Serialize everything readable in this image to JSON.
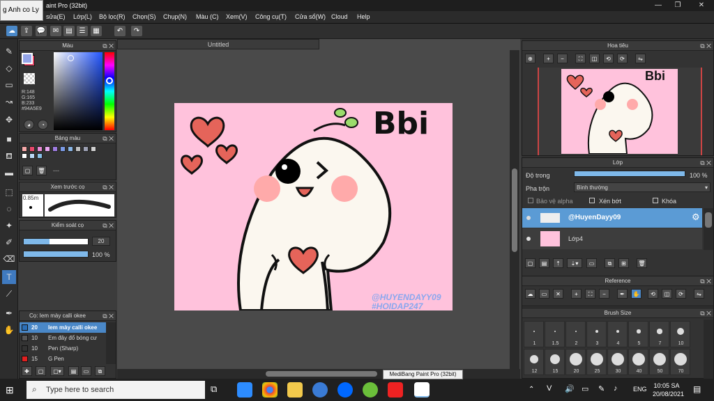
{
  "app": {
    "title": "aint Pro (32bit)",
    "tooltip_left": "g Anh co Ly"
  },
  "window_controls": {
    "minimize": "—",
    "maximize": "❐",
    "close": "✕"
  },
  "menu": [
    "sửa(E)",
    "Lớp(L)",
    "Bộ lọc(R)",
    "Chọn(S)",
    "Chụp(N)",
    "Màu (C)",
    "Xem(V)",
    "Công cụ(T)",
    "Cửa sổ(W)",
    "Cloud",
    "Help"
  ],
  "doc_tab": "Untitled",
  "artwork": {
    "text_bbi": "Bbi",
    "watermark1": "@HUYENDAYY09",
    "watermark2": "#HOIDAP247",
    "bg_color": "#ffc2dc"
  },
  "color_panel": {
    "title": "Màu",
    "r": "R:148",
    "g": "G:165",
    "b": "B:233",
    "hex": "#94A5E9",
    "current_color": "#94A5E9"
  },
  "palette_panel": {
    "title": "Bảng màu",
    "swatches": [
      "#f6a9a9",
      "#e8476b",
      "#e88ad6",
      "#e9a6f0",
      "#9d7be0",
      "#7b9be6",
      "#8ab6e6",
      "#c0c0c0",
      "#9ca0b3",
      "#d0d0d0",
      "#ffffff",
      "#b9d8f5",
      "#88c1e8"
    ],
    "footer": "---"
  },
  "brush_preview": {
    "title": "Xem trước cọ",
    "size": "0.85m"
  },
  "brush_control": {
    "title": "Kiểm soát cọ",
    "size_value": "20",
    "opacity_value": "100 %",
    "size_frac": 0.4,
    "opacity_frac": 1.0
  },
  "brush_list": {
    "title": "Cọ: Iem mày calli okee",
    "items": [
      {
        "size": "20",
        "name": "Iem mày calli okee",
        "color": "#2b6fb8"
      },
      {
        "size": "10",
        "name": "Em đây đổ bóng cư",
        "color": "#555"
      },
      {
        "size": "10",
        "name": "Pen (Sharp)",
        "color": "#333"
      },
      {
        "size": "15",
        "name": "G Pen",
        "color": "#e02020"
      }
    ]
  },
  "navigator": {
    "title": "Hoa tiêu",
    "preview_text": "Bbi"
  },
  "layer_panel": {
    "title": "Lớp",
    "opacity_label": "Độ trong",
    "opacity_value": "100 %",
    "blend_label": "Pha trộn",
    "blend_value": "Bình thường",
    "protect_alpha": "Bảo vệ alpha",
    "clip": "Xén bớt",
    "lock": "Khóa",
    "layers": [
      {
        "name": "@HuyenDayy09",
        "selected": true
      },
      {
        "name": "Lớp4",
        "selected": false
      }
    ]
  },
  "reference_panel": {
    "title": "Reference"
  },
  "brush_size_panel": {
    "title": "Brush Size",
    "row1": [
      "1",
      "1.5",
      "2",
      "3",
      "4",
      "5",
      "7",
      "10"
    ],
    "row2": [
      "12",
      "15",
      "20",
      "25",
      "30",
      "40",
      "50",
      "70"
    ]
  },
  "taskbar": {
    "search_placeholder": "Type here to search",
    "lang": "ENG",
    "time": "10:05 SA",
    "date": "20/08/2021",
    "tooltip": "MediBang Paint Pro (32bit)"
  }
}
